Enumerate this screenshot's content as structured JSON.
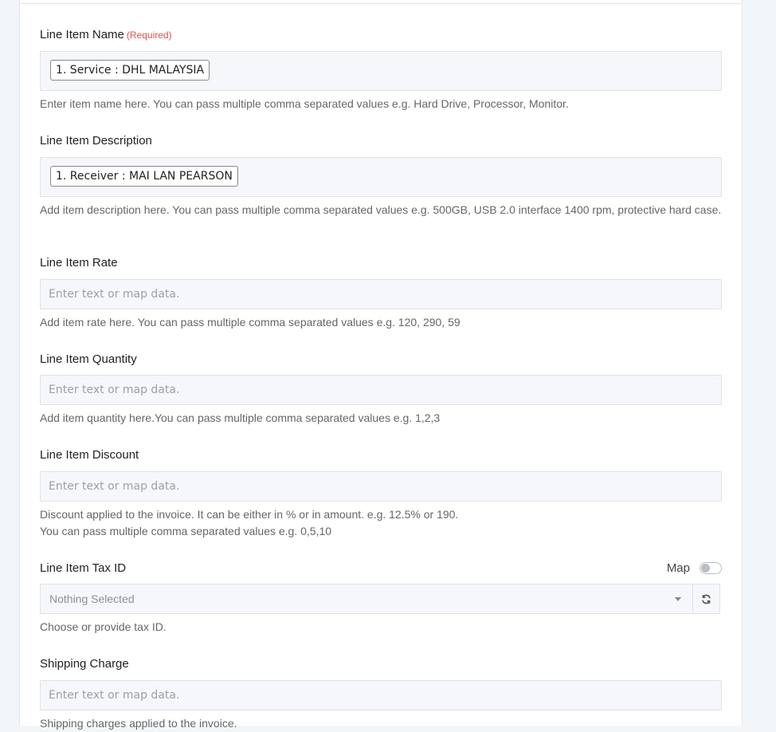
{
  "fields": {
    "name": {
      "label": "Line Item Name",
      "required": "(Required)",
      "chip": "1. Service : DHL MALAYSIA",
      "help": "Enter item name here. You can pass multiple comma separated values e.g. Hard Drive, Processor, Monitor."
    },
    "description": {
      "label": "Line Item Description",
      "chip": "1. Receiver : MAI LAN PEARSON",
      "help": "Add item description here. You can pass multiple comma separated values e.g. 500GB, USB 2.0 interface 1400 rpm, protective hard case."
    },
    "rate": {
      "label": "Line Item Rate",
      "placeholder": "Enter text or map data.",
      "help": "Add item rate here. You can pass multiple comma separated values e.g. 120, 290, 59"
    },
    "quantity": {
      "label": "Line Item Quantity",
      "placeholder": "Enter text or map data.",
      "help": "Add item quantity here.You can pass multiple comma separated values e.g. 1,2,3"
    },
    "discount": {
      "label": "Line Item Discount",
      "placeholder": "Enter text or map data.",
      "help_line1": "Discount applied to the invoice. It can be either in % or in amount. e.g. 12.5% or 190.",
      "help_line2": "You can pass multiple comma separated values e.g. 0,5,10"
    },
    "tax": {
      "label": "Line Item Tax ID",
      "map_label": "Map",
      "map_enabled": false,
      "selected": "Nothing Selected",
      "help": "Choose or provide tax ID."
    },
    "shipping": {
      "label": "Shipping Charge",
      "placeholder": "Enter text or map data.",
      "help": "Shipping charges applied to the invoice."
    }
  },
  "icons": {
    "tax_caret": "caret-down-icon",
    "tax_refresh": "refresh-icon"
  }
}
